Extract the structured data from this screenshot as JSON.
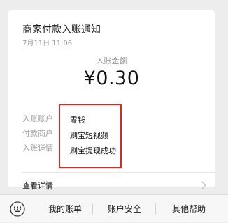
{
  "notification": {
    "title": "商家付款入账通知",
    "time": "7月11日 11:06",
    "amount_label": "入账金额",
    "amount": "¥0.30",
    "details": [
      {
        "label": "入账账户",
        "value": "零钱"
      },
      {
        "label": "付款商户",
        "value": "刷宝短视频"
      },
      {
        "label": "入账详情",
        "value": "刷宝提现成功"
      }
    ],
    "view_details": "查看详情",
    "highlight_color": "#e8231c"
  },
  "menubar": {
    "keyboard_icon": "keyboard-icon",
    "items": [
      "我的账单",
      "账户安全",
      "其他帮助"
    ]
  }
}
